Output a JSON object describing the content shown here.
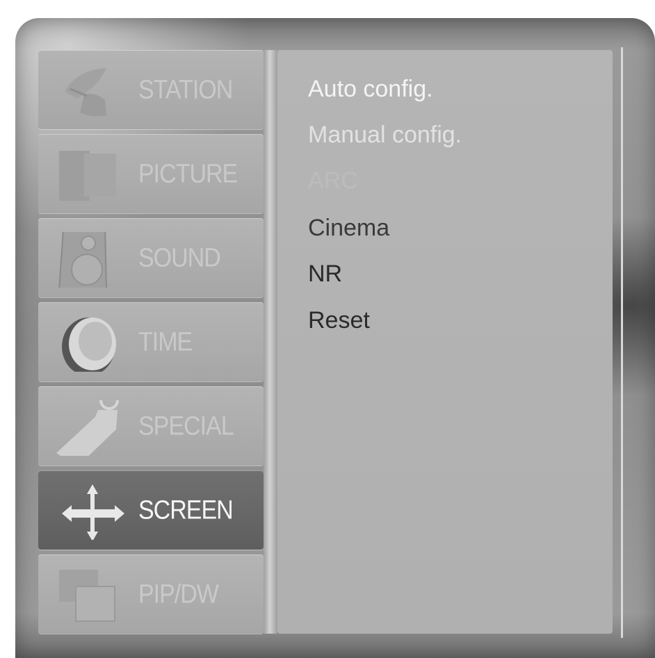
{
  "menu": {
    "items": [
      {
        "label": "STATION",
        "icon": "satellite-dish-icon"
      },
      {
        "label": "PICTURE",
        "icon": "screen-icon"
      },
      {
        "label": "SOUND",
        "icon": "speaker-icon"
      },
      {
        "label": "TIME",
        "icon": "clock-icon"
      },
      {
        "label": "SPECIAL",
        "icon": "tag-icon"
      },
      {
        "label": "SCREEN",
        "icon": "move-arrows-icon",
        "selected": true
      },
      {
        "label": "PIP/DW",
        "icon": "pip-windows-icon"
      }
    ]
  },
  "submenu": {
    "items": [
      {
        "label": "Auto config."
      },
      {
        "label": "Manual config."
      },
      {
        "label": "ARC"
      },
      {
        "label": "Cinema"
      },
      {
        "label": "NR"
      },
      {
        "label": "Reset"
      }
    ]
  },
  "colors": {
    "panel": "#b2b2b2",
    "selected_item": "#666666",
    "frame": "#8c8c8c"
  }
}
